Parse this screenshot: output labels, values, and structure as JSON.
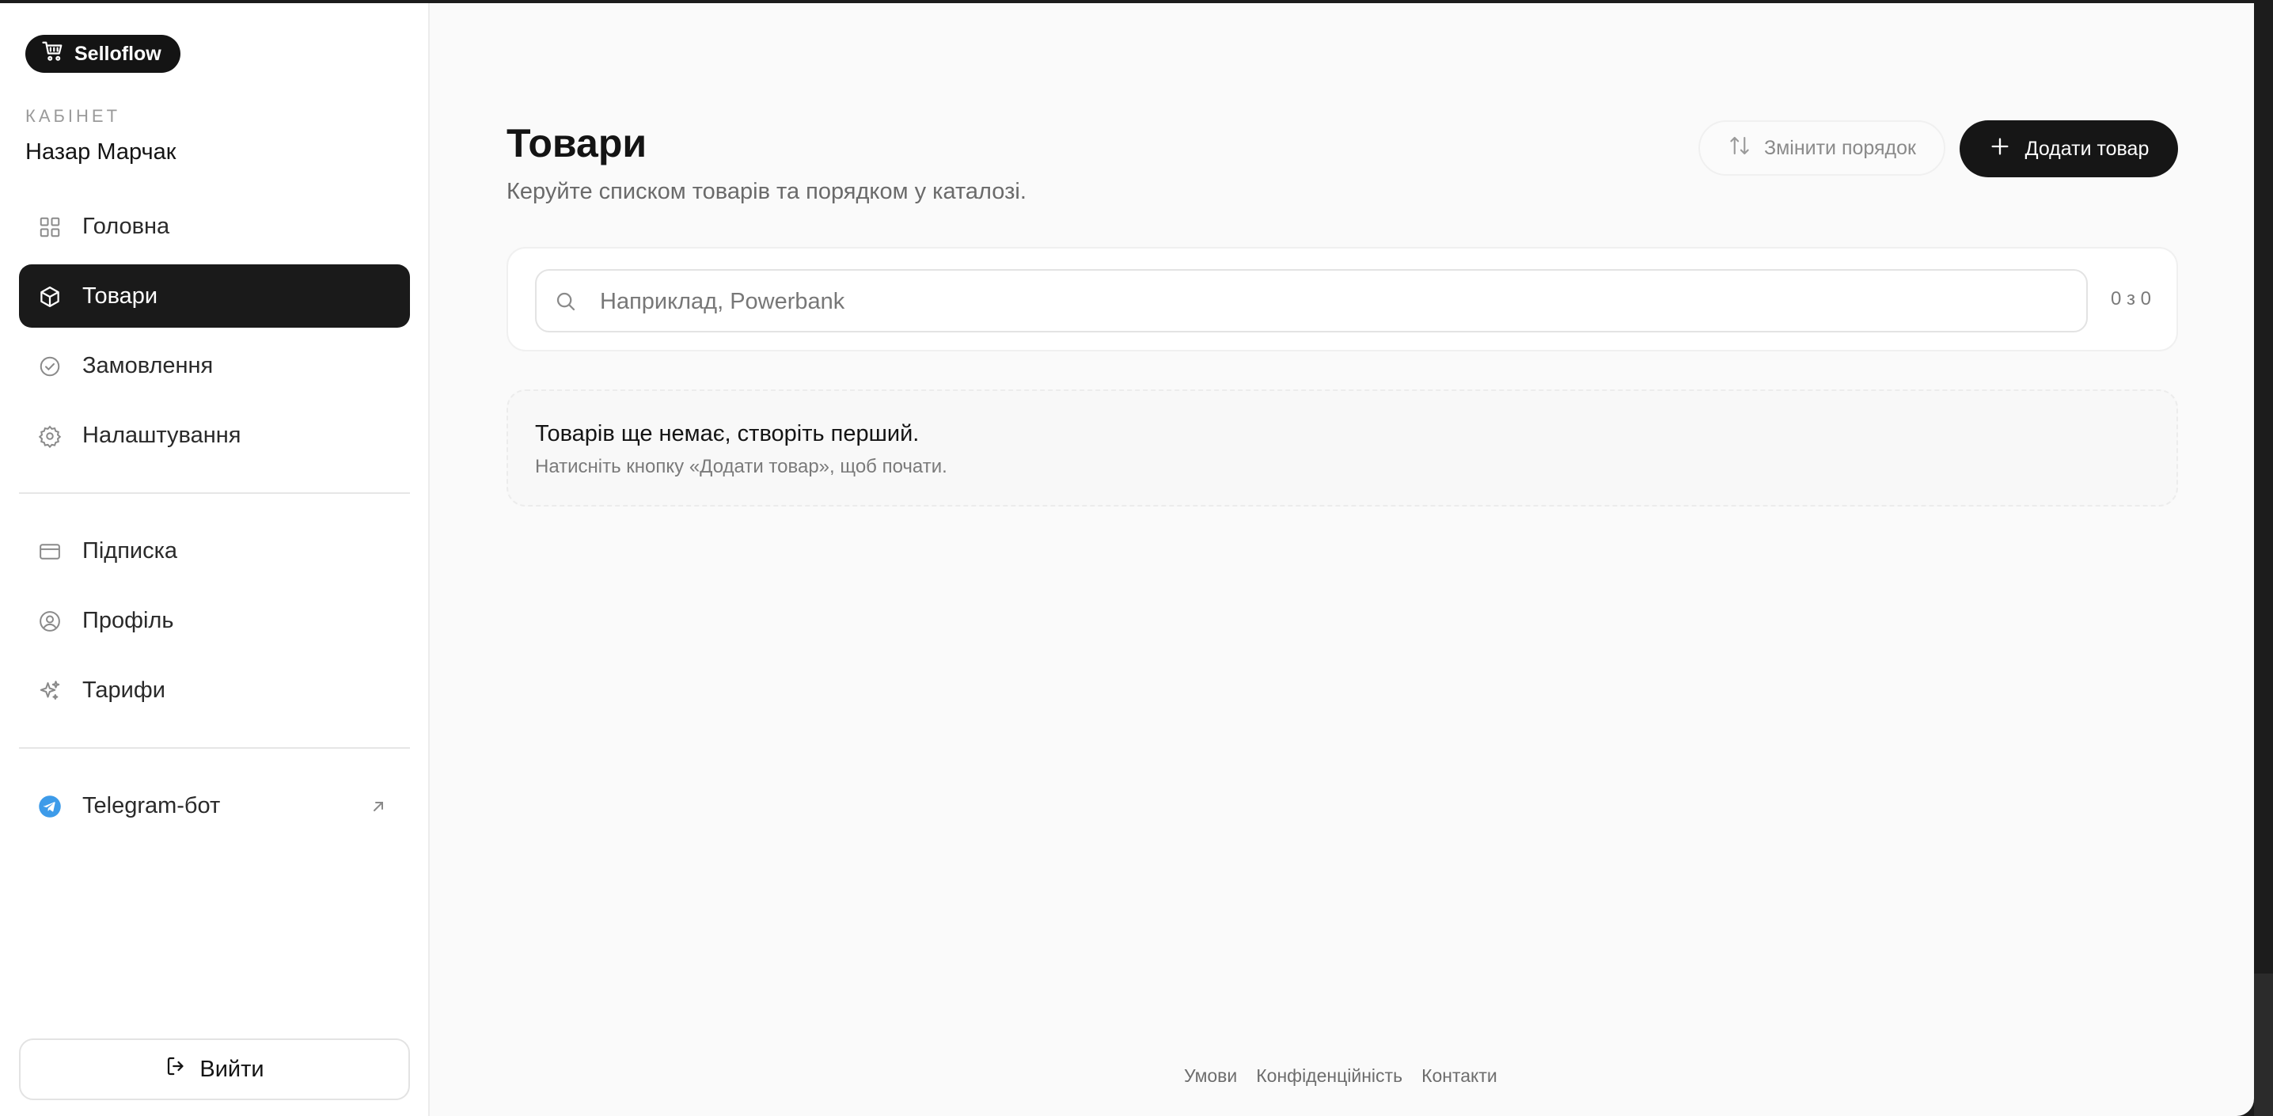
{
  "brand": {
    "name": "Selloflow",
    "icon": "cart-icon"
  },
  "sidebar": {
    "cabinet_label": "КАБІНЕТ",
    "user_name": "Назар Марчак",
    "items": [
      {
        "label": "Головна",
        "icon": "grid-icon",
        "active": false
      },
      {
        "label": "Товари",
        "icon": "box-icon",
        "active": true
      },
      {
        "label": "Замовлення",
        "icon": "check-circle-icon",
        "active": false
      },
      {
        "label": "Налаштування",
        "icon": "gear-icon",
        "active": false
      }
    ],
    "secondary_items": [
      {
        "label": "Підписка",
        "icon": "credit-card-icon"
      },
      {
        "label": "Профіль",
        "icon": "user-circle-icon"
      },
      {
        "label": "Тарифи",
        "icon": "sparkles-icon"
      }
    ],
    "telegram": {
      "label": "Telegram-бот",
      "icon": "telegram-icon",
      "ext_icon": "arrow-up-right-icon"
    },
    "logout_label": "Вийти"
  },
  "main": {
    "title": "Товари",
    "subtitle": "Керуйте списком товарів та порядком у каталозі.",
    "reorder_label": "Змінити порядок",
    "add_label": "Додати товар",
    "search": {
      "placeholder": "Наприклад, Powerbank",
      "value": "",
      "count": "0 з 0"
    },
    "empty": {
      "title": "Товарів ще немає, створіть перший.",
      "hint": "Натисніть кнопку «Додати товар», щоб почати."
    }
  },
  "footer": {
    "links": [
      "Умови",
      "Конфіденційність",
      "Контакти"
    ]
  },
  "colors": {
    "accent": "#1a1a1a",
    "telegram": "#3d9be9",
    "background": "#fafafa"
  }
}
